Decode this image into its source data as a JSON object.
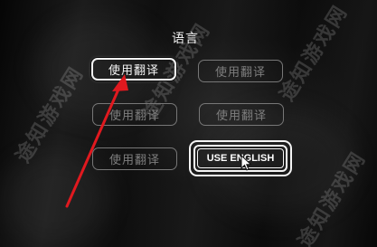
{
  "language_menu": {
    "title": "语言",
    "buttons": [
      {
        "label": "使用翻译",
        "state": "active"
      },
      {
        "label": "使用翻译",
        "state": "dim"
      },
      {
        "label": "使用翻译",
        "state": "dim"
      },
      {
        "label": "使用翻译",
        "state": "dim"
      },
      {
        "label": "使用翻译",
        "state": "dim"
      },
      {
        "label": "USE ENGLISH",
        "state": "selected"
      }
    ]
  },
  "annotation": {
    "arrow_color": "#e0191f"
  },
  "watermark": {
    "text": "途知游戏网"
  },
  "colors": {
    "active_text": "#f4f4f4",
    "dim_text": "#7e7e7e",
    "background": "#0a0a0a"
  }
}
